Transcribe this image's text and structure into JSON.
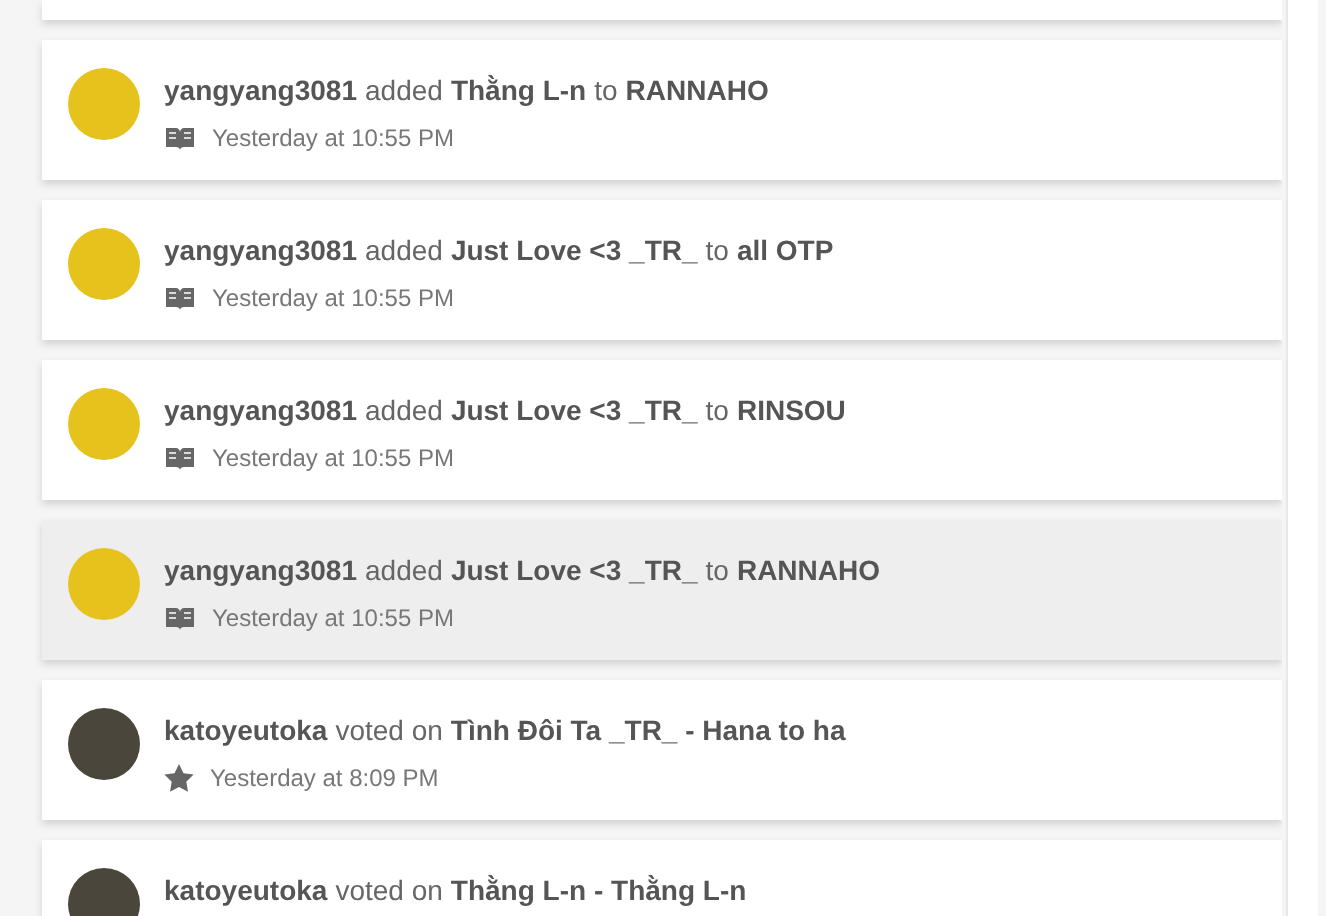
{
  "activities": [
    {
      "user": "yangyang3081",
      "action": "added",
      "story": "Thằng L-n",
      "connector": "to",
      "target": "RANNAHO",
      "kind": "library",
      "time": "Yesterday at 10:55 PM",
      "color": "#e6c21c",
      "selected": false
    },
    {
      "user": "yangyang3081",
      "action": "added",
      "story": "Just Love <3 _TR_",
      "connector": "to",
      "target": "all OTP",
      "kind": "library",
      "time": "Yesterday at 10:55 PM",
      "color": "#e6c21c",
      "selected": false
    },
    {
      "user": "yangyang3081",
      "action": "added",
      "story": "Just Love <3 _TR_",
      "connector": "to",
      "target": "RINSOU",
      "kind": "library",
      "time": "Yesterday at 10:55 PM",
      "color": "#e6c21c",
      "selected": false
    },
    {
      "user": "yangyang3081",
      "action": "added",
      "story": "Just Love <3 _TR_",
      "connector": "to",
      "target": "RANNAHO",
      "kind": "library",
      "time": "Yesterday at 10:55 PM",
      "color": "#e6c21c",
      "selected": true
    },
    {
      "user": "katoyeutoka",
      "action": "voted on",
      "story": "Tình Đôi Ta _TR_ - Hana to ha",
      "kind": "vote",
      "time": "Yesterday at 8:09 PM",
      "color": "#4a463c",
      "selected": false
    },
    {
      "user": "katoyeutoka",
      "action": "voted on",
      "story": "Thằng L-n - Thằng L-n",
      "color": "#4a463c",
      "selected": false
    }
  ]
}
